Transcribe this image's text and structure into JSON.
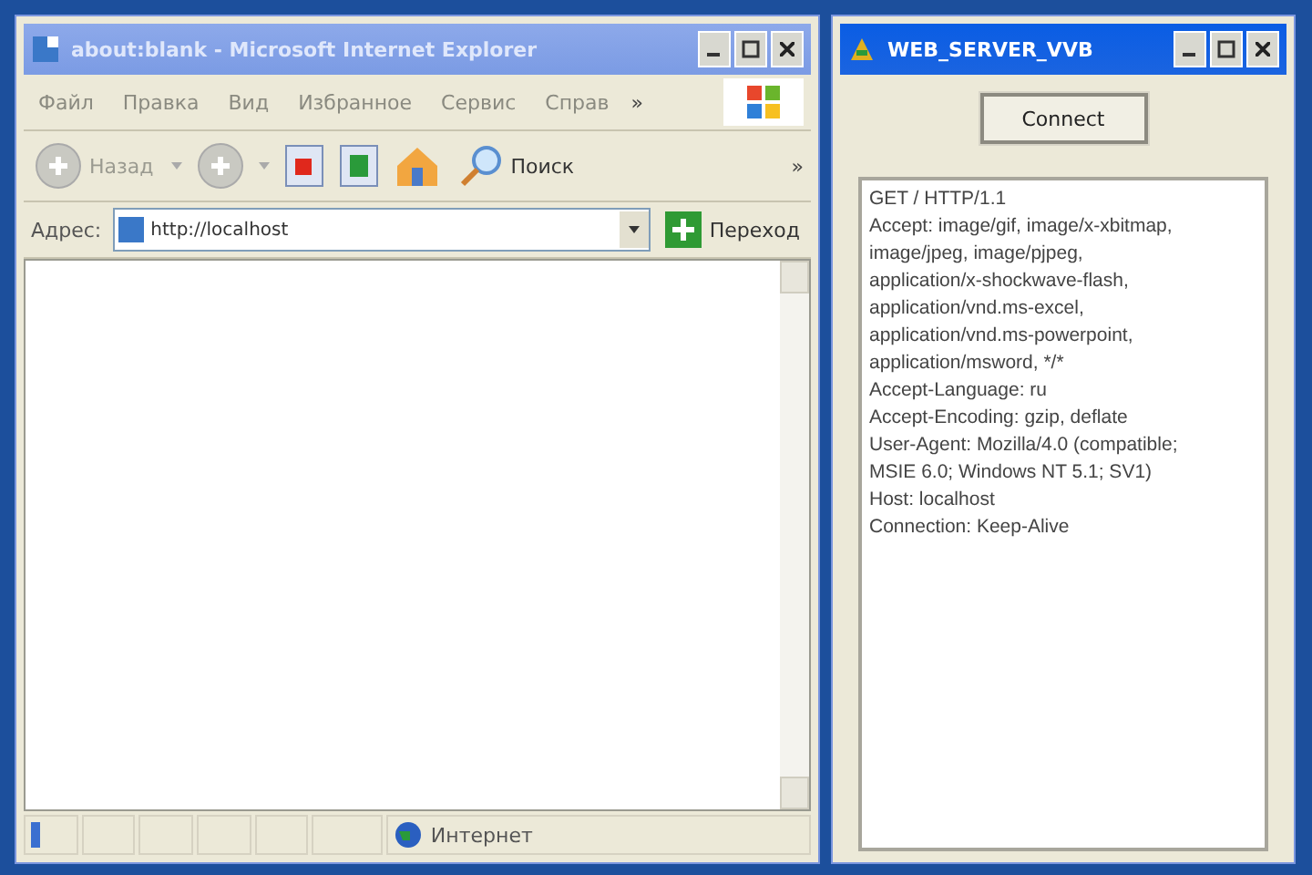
{
  "browser": {
    "title": "about:blank - Microsoft Internet Explorer",
    "active": false,
    "menu": [
      "Файл",
      "Правка",
      "Вид",
      "Избранное",
      "Сервис",
      "Справ"
    ],
    "more": "»",
    "toolbar": {
      "back": "Назад",
      "search": "Поиск",
      "more": "»"
    },
    "address": {
      "label": "Адрес:",
      "value": "http://localhost",
      "go": "Переход"
    },
    "status": {
      "zone": "Интернет"
    }
  },
  "server": {
    "title": "WEB_SERVER_VVB",
    "active": true,
    "button": "Connect",
    "lines": [
      "GET / HTTP/1.1",
      "Accept: image/gif, image/x-xbitmap,",
      "image/jpeg, image/pjpeg,",
      "application/x-shockwave-flash,",
      "application/vnd.ms-excel,",
      "application/vnd.ms-powerpoint,",
      "application/msword, */*",
      "Accept-Language: ru",
      "Accept-Encoding: gzip, deflate",
      "User-Agent: Mozilla/4.0 (compatible;",
      "MSIE 6.0; Windows NT 5.1; SV1)",
      "Host: localhost",
      "Connection: Keep-Alive"
    ]
  }
}
